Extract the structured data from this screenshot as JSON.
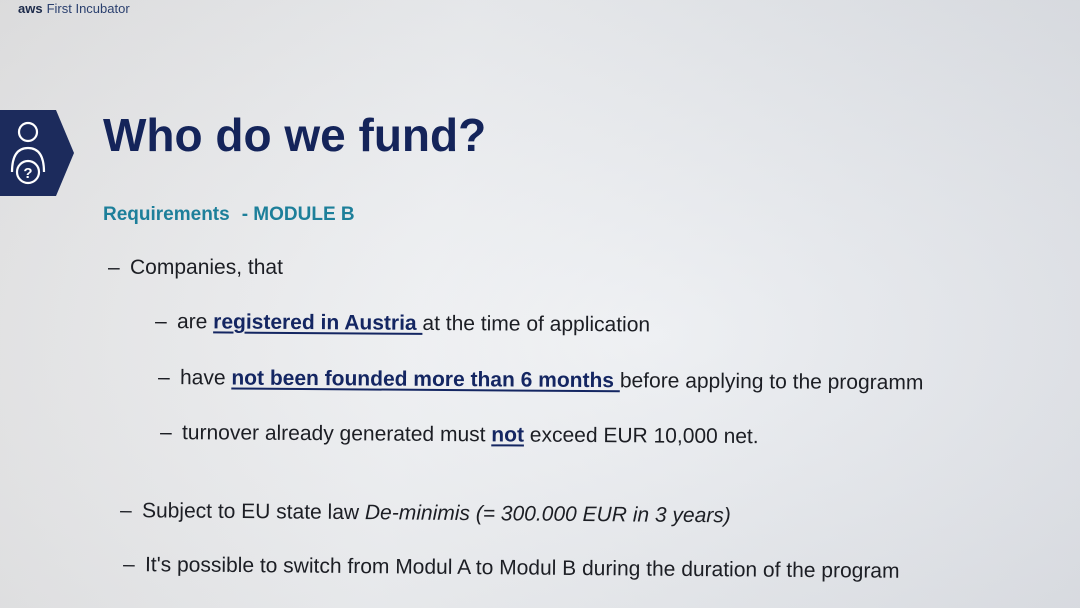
{
  "brand": {
    "prefix": "aws",
    "name": "First Incubator"
  },
  "slide": {
    "icon": "person-question-icon",
    "title": "Who do we fund?",
    "subtitle": {
      "label": "Requirements",
      "module": "- MODULE B"
    },
    "bullets": {
      "companies": "Companies, that",
      "registered": {
        "pre": "are ",
        "emph": "registered in Austria ",
        "post": "at the time of application"
      },
      "founded": {
        "pre": "have ",
        "emph": "not been founded more than 6 months ",
        "post": "before applying to the programm"
      },
      "turnover": {
        "pre": "turnover already generated must ",
        "emph": "not",
        "post": " exceed EUR 10,000 net."
      },
      "deminimis": {
        "pre": "Subject to EU state law ",
        "emph": "De-minimis (= 300.000 EUR in 3 years)"
      },
      "switch": "It's possible to switch from Modul A to Modul B during the duration of the program"
    }
  },
  "colors": {
    "title": "#14245a",
    "subtitle": "#1d7f9a",
    "badge": "#1c2b5c"
  }
}
